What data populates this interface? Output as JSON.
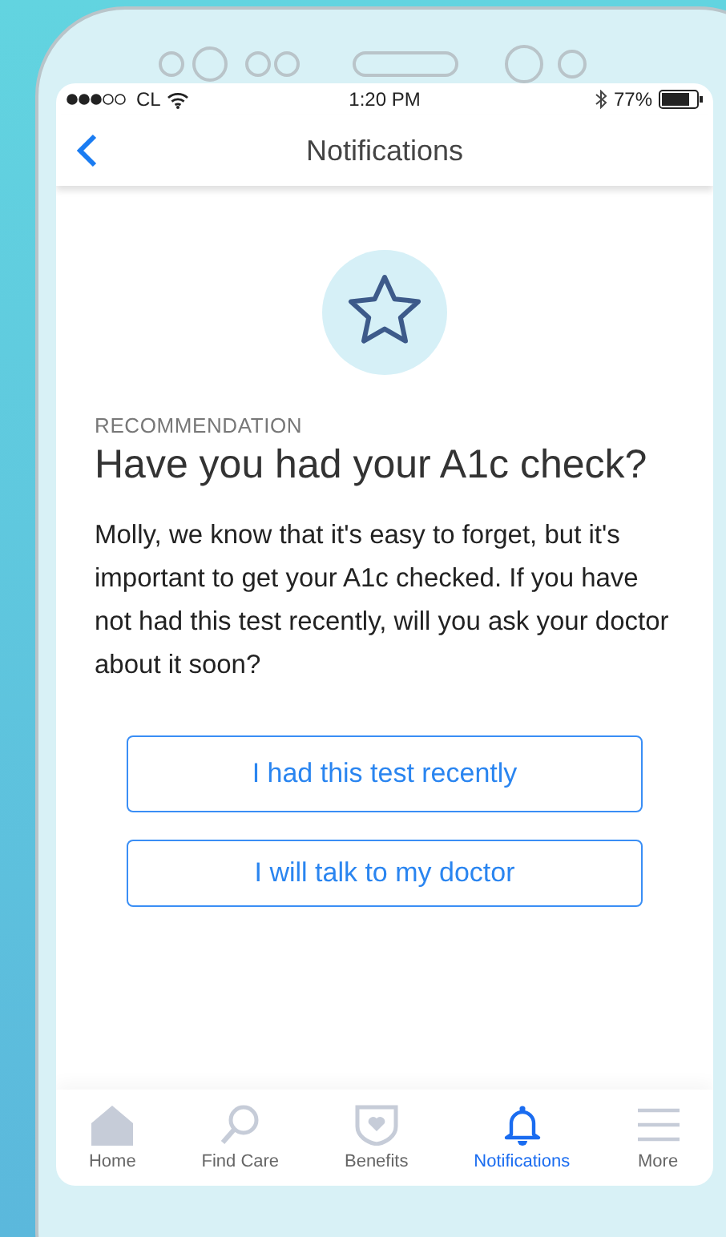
{
  "status_bar": {
    "carrier": "CL",
    "time": "1:20 PM",
    "battery": "77%"
  },
  "nav": {
    "title": "Notifications"
  },
  "card": {
    "label": "RECOMMENDATION",
    "title": "Have you had your A1c check?",
    "body": "Molly, we know that it's easy to forget, but it's important to get your A1c checked. If you have not had this test recently, will you ask your doctor about it soon?"
  },
  "buttons": [
    "I had this test recently",
    "I will talk to my doctor"
  ],
  "tab_bar": [
    {
      "kind": "home",
      "label": "Home",
      "selected": false
    },
    {
      "kind": "search",
      "label": "Find Care",
      "selected": false
    },
    {
      "kind": "shield",
      "label": "Benefits",
      "selected": false
    },
    {
      "kind": "bell",
      "label": "Notifications",
      "selected": true
    },
    {
      "kind": "menu",
      "label": "More",
      "selected": false
    }
  ]
}
